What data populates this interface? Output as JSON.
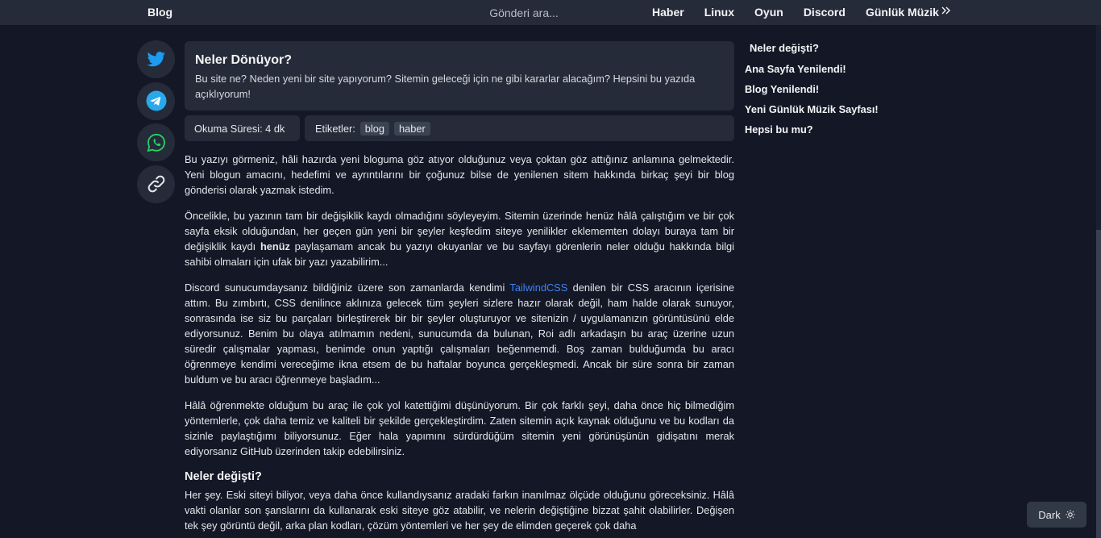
{
  "header": {
    "brand": "Blog",
    "search_placeholder": "Gönderi ara...",
    "nav": [
      "Haber",
      "Linux",
      "Oyun",
      "Discord",
      "Günlük Müzik"
    ]
  },
  "social": {
    "icons": [
      "twitter-icon",
      "telegram-icon",
      "whatsapp-icon",
      "link-icon"
    ],
    "colors": {
      "twitter": "#1d9bf0",
      "telegram": "#29a9eb",
      "whatsapp": "#25d366",
      "link": "#e5e7eb"
    }
  },
  "intro": {
    "title": "Neler Dönüyor?",
    "description": "Bu site ne? Neden yeni bir site yapıyorum? Sitemin geleceği için ne gibi kararlar alacağım? Hepsini bu yazıda açıklıyorum!"
  },
  "meta": {
    "reading_time": "Okuma Süresi: 4 dk",
    "tags_label": "Etiketler:",
    "tags": [
      "blog",
      "haber"
    ]
  },
  "article": {
    "p1": "Bu yazıyı görmeniz, hâli hazırda yeni bloguma göz atıyor olduğunuz veya çoktan göz attığınız anlamına gelmektedir. Yeni blogun amacını, hedefimi ve ayrıntılarını bir çoğunuz bilse de yenilenen sitem hakkında birkaç şeyi bir blog gönderisi olarak yazmak istedim.",
    "p2_before": "Öncelikle, bu yazının tam bir değişiklik kaydı olmadığını söyleyeyim. Sitemin üzerinde henüz hâlâ çalıştığım ve bir çok sayfa eksik olduğundan, her geçen gün yeni bir şeyler keşfedim siteye yenilikler eklememten dolayı buraya tam bir değişiklik kaydı ",
    "p2_bold": "henüz",
    "p2_after": " paylaşamam ancak bu yazıyı okuyanlar ve bu sayfayı görenlerin neler olduğu hakkında bilgi sahibi olmaları için ufak bir yazı yazabilirim...",
    "p3_before": "Discord sunucumdaysanız bildiğiniz üzere son zamanlarda kendimi ",
    "p3_link": "TailwindCSS",
    "p3_after": " denilen bir CSS aracının içerisine attım. Bu zımbırtı, CSS denilince aklınıza gelecek tüm şeyleri sizlere hazır olarak değil, ham halde olarak sunuyor, sonrasında ise siz bu parçaları birleştirerek bir bir şeyler oluşturuyor ve sitenizin / uygulamanızın görüntüsünü elde ediyorsunuz. Benim bu olaya atılmamın nedeni, sunucumda da bulunan, Roi adlı arkadaşın bu araç üzerine uzun süredir çalışmalar yapması, benimde onun yaptığı çalışmaları beğenmemdi. Boş zaman bulduğumda bu aracı öğrenmeye kendimi vereceğime ikna etsem de bu haftalar boyunca gerçekleşmedi. Ancak bir süre sonra bir zaman buldum ve bu aracı öğrenmeye başladım...",
    "p4": "Hâlâ öğrenmekte olduğum bu araç ile çok yol katettiğimi düşünüyorum. Bir çok farklı şeyi, daha önce hiç bilmediğim yöntemlerle, çok daha temiz ve kaliteli bir şekilde gerçekleştirdim. Zaten sitemin açık kaynak olduğunu ve bu kodları da sizinle paylaştığımı biliyorsunuz. Eğer hala yapımını sürdürdüğüm sitemin yeni görünüşünün gidişatını merak ediyorsanız GitHub üzerinden takip edebilirsiniz.",
    "h2": "Neler değişti?",
    "p5": "Her şey. Eski siteyi biliyor, veya daha önce kullandıysanız aradaki farkın inanılmaz ölçüde olduğunu göreceksiniz. Hâlâ vakti olanlar son şanslarını da kullanarak eski siteye göz atabilir, ve nelerin değiştiğine bizzat şahit olabilirler. Değişen tek şey görüntü değil, arka plan kodları, çözüm yöntemleri ve her şey de elimden geçerek çok daha"
  },
  "toc": {
    "head": "Neler değişti?",
    "items": [
      "Ana Sayfa Yenilendi!",
      "Blog Yenilendi!",
      "Yeni Günlük Müzik Sayfası!",
      "Hepsi bu mu?"
    ]
  },
  "theme_toggle": {
    "label": "Dark",
    "icon": "sun-icon"
  }
}
